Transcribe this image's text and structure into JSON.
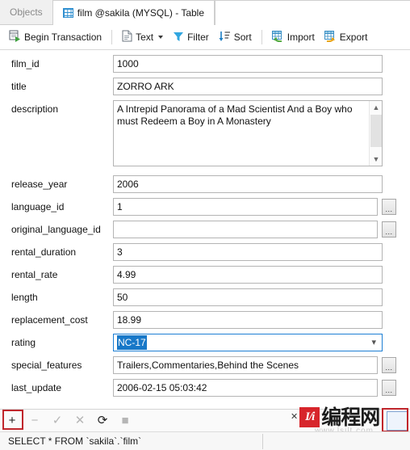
{
  "tabs": [
    {
      "label": "Objects",
      "icon": "",
      "active": false
    },
    {
      "label": "film @sakila (MYSQL) - Table",
      "icon": "table-grid-icon",
      "active": true
    }
  ],
  "toolbar": {
    "begin_transaction": "Begin Transaction",
    "text": "Text",
    "filter": "Filter",
    "sort": "Sort",
    "import": "Import",
    "export": "Export"
  },
  "form": {
    "fields": [
      {
        "label": "film_id",
        "value": "1000",
        "type": "text",
        "ellipsis": false
      },
      {
        "label": "title",
        "value": "ZORRO ARK",
        "type": "text",
        "ellipsis": false
      },
      {
        "label": "description",
        "value": "A Intrepid Panorama of a Mad Scientist And a Boy who must Redeem a Boy in A Monastery",
        "type": "textarea",
        "ellipsis": false
      },
      {
        "label": "release_year",
        "value": "2006",
        "type": "text",
        "ellipsis": false
      },
      {
        "label": "language_id",
        "value": "1",
        "type": "text",
        "ellipsis": true
      },
      {
        "label": "original_language_id",
        "value": "",
        "type": "text",
        "ellipsis": true
      },
      {
        "label": "rental_duration",
        "value": "3",
        "type": "text",
        "ellipsis": false
      },
      {
        "label": "rental_rate",
        "value": "4.99",
        "type": "text",
        "ellipsis": false
      },
      {
        "label": "length",
        "value": "50",
        "type": "text",
        "ellipsis": false
      },
      {
        "label": "replacement_cost",
        "value": "18.99",
        "type": "text",
        "ellipsis": false
      },
      {
        "label": "rating",
        "value": "NC-17",
        "type": "combo",
        "ellipsis": false
      },
      {
        "label": "special_features",
        "value": "Trailers,Commentaries,Behind the Scenes",
        "type": "text",
        "ellipsis": true
      },
      {
        "label": "last_update",
        "value": "2006-02-15 05:03:42",
        "type": "text",
        "ellipsis": true
      }
    ],
    "ellipsis_label": "...",
    "combo_arrow": "⌄"
  },
  "nav": {
    "add": "+",
    "remove": "−",
    "confirm": "✓",
    "cancel": "✕",
    "refresh": "⟳",
    "stop": "■"
  },
  "status": {
    "query": "SELECT * FROM `sakila`.`film`"
  },
  "watermark": {
    "pin": "✕",
    "badge": "I/i",
    "text": "编程网",
    "sub": "www.lsjlt.com"
  },
  "colors": {
    "accent_blue": "#1878c8",
    "focus_border": "#1d7fd4",
    "highlight_red": "#c0262c",
    "tab_icon_blue": "#2f8fd0",
    "watermark_red": "#d7252b"
  }
}
